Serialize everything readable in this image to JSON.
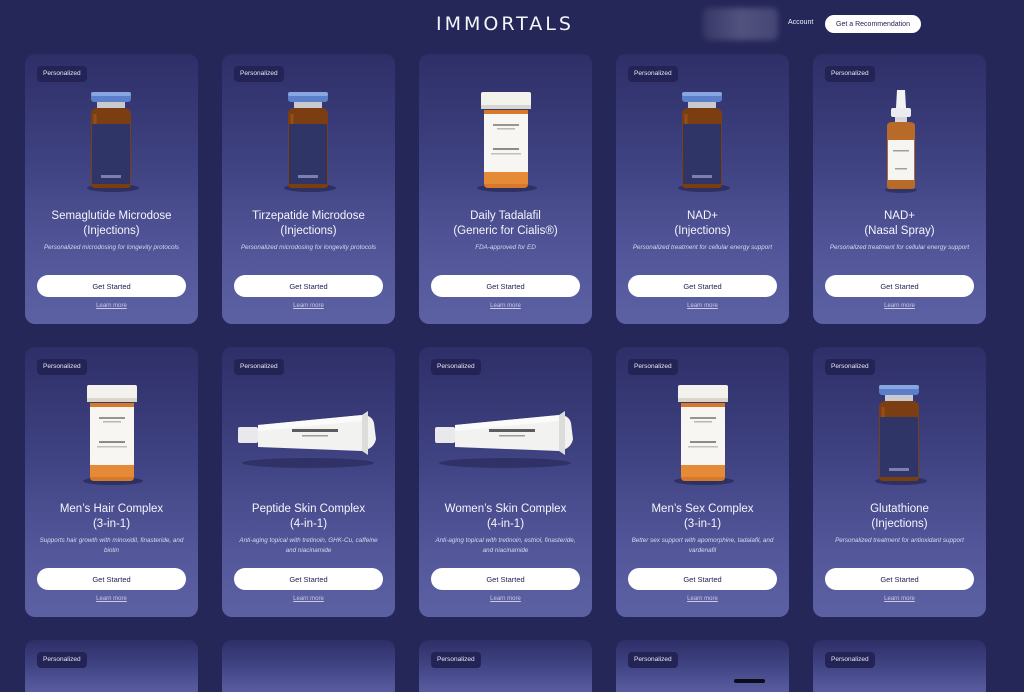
{
  "header": {
    "logo": "IMMORTALS",
    "account_label": "Account",
    "recommend_label": "Get a Recommendation"
  },
  "products": [
    {
      "badge": "Personalized",
      "title_line1": "Semaglutide Microdose",
      "title_line2": "(Injections)",
      "description": "Personalized microdosing for longevity protocols",
      "cta": "Get Started",
      "learn": "Learn more",
      "product_type": "vial-icon",
      "label": "Microdose"
    },
    {
      "badge": "Personalized",
      "title_line1": "Tirzepatide Microdose",
      "title_line2": "(Injections)",
      "description": "Personalized microdosing for longevity protocols",
      "cta": "Get Started",
      "learn": "Learn more",
      "product_type": "vial-icon",
      "label": "Microdose"
    },
    {
      "badge": "",
      "title_line1": "Daily Tadalafil",
      "title_line2": "(Generic for Cialis®)",
      "description": "FDA-approved for ED",
      "cta": "Get Started",
      "learn": "Learn more",
      "product_type": "pill-bottle-icon",
      "label": "Tadalafil"
    },
    {
      "badge": "Personalized",
      "title_line1": "NAD+",
      "title_line2": "(Injections)",
      "description": "Personalized treatment for cellular energy support",
      "cta": "Get Started",
      "learn": "Learn more",
      "product_type": "vial-icon",
      "label": "IMMORTALS"
    },
    {
      "badge": "Personalized",
      "title_line1": "NAD+",
      "title_line2": "(Nasal Spray)",
      "description": "Personalized treatment for cellular energy support",
      "cta": "Get Started",
      "learn": "Learn more",
      "product_type": "nasal-spray-icon",
      "label": "IMMORTALS"
    },
    {
      "badge": "Personalized",
      "title_line1": "Men’s Hair Complex",
      "title_line2": "(3-in-1)",
      "description": "Supports hair growth with minoxidil, finasteride, and biotin",
      "cta": "Get Started",
      "learn": "Learn more",
      "product_type": "pill-bottle-icon",
      "label": "Hair Complex"
    },
    {
      "badge": "Personalized",
      "title_line1": "Peptide Skin Complex",
      "title_line2": "(4-in-1)",
      "description": "Anti-aging topical with tretinoin, GHK-Cu, caffeine and niacinamide",
      "cta": "Get Started",
      "learn": "Learn more",
      "product_type": "tube-icon",
      "label": "IMMORTALS"
    },
    {
      "badge": "Personalized",
      "title_line1": "Women’s Skin Complex",
      "title_line2": "(4-in-1)",
      "description": "Anti-aging topical with tretinoin, estriol, finasteride, and niacinamide",
      "cta": "Get Started",
      "learn": "Learn more",
      "product_type": "tube-icon",
      "label": "IMMORTALS"
    },
    {
      "badge": "Personalized",
      "title_line1": "Men’s Sex Complex",
      "title_line2": "(3-in-1)",
      "description": "Better sex support with apomorphine, tadalafil, and vardenafil",
      "cta": "Get Started",
      "learn": "Learn more",
      "product_type": "pill-bottle-icon",
      "label": "Sex Complex"
    },
    {
      "badge": "Personalized",
      "title_line1": "Glutathione",
      "title_line2": "(Injections)",
      "description": "Personalized treatment for antioxidant support",
      "cta": "Get Started",
      "learn": "Learn more",
      "product_type": "vial-icon",
      "label": "IMMORTALS"
    }
  ],
  "row3_badges": [
    "Personalized",
    "",
    "Personalized",
    "Personalized",
    "Personalized"
  ]
}
